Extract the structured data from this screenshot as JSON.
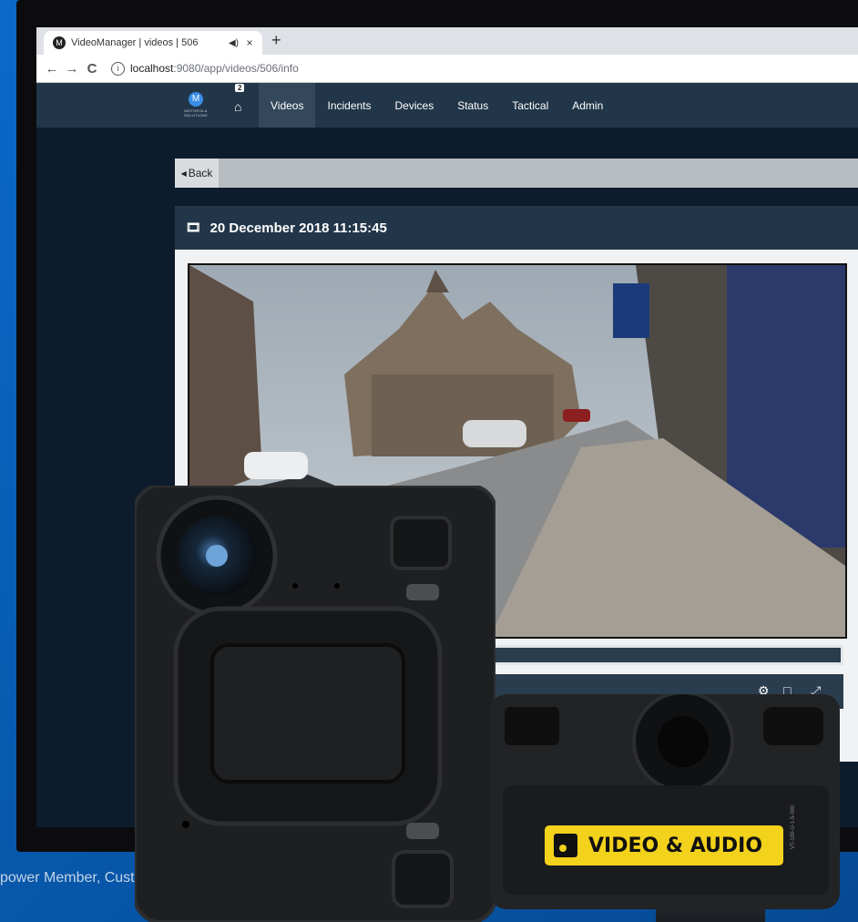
{
  "browser": {
    "tab_title": "VideoManager | videos | 506",
    "favicon": "motorola-icon",
    "audio_icon": "speaker-icon",
    "close_label": "×",
    "new_tab_label": "+",
    "back_label": "←",
    "forward_label": "→",
    "reload_label": "C",
    "info_label": "i",
    "url_host": "localhost",
    "url_path": ":9080/app/videos/506/info"
  },
  "app": {
    "logo_text": "MOTOROLA SOLUTIONS",
    "home_badge": "2",
    "nav": [
      "Videos",
      "Incidents",
      "Devices",
      "Status",
      "Tactical",
      "Admin"
    ],
    "active_nav": "Videos",
    "back_label": "Back",
    "video_title": "20 December 2018 11:15:45"
  },
  "overlay": {
    "disclaimer": "power Member, Customer, and Prospective Customer Use Only",
    "label_video_audio": "VIDEO & AUDIO",
    "serial_text": "VT-100-U-1-5-000"
  },
  "colors": {
    "nav_bg": "#223649",
    "accent_yellow": "#f2d21b",
    "brand_blue": "#0a5fb8"
  }
}
